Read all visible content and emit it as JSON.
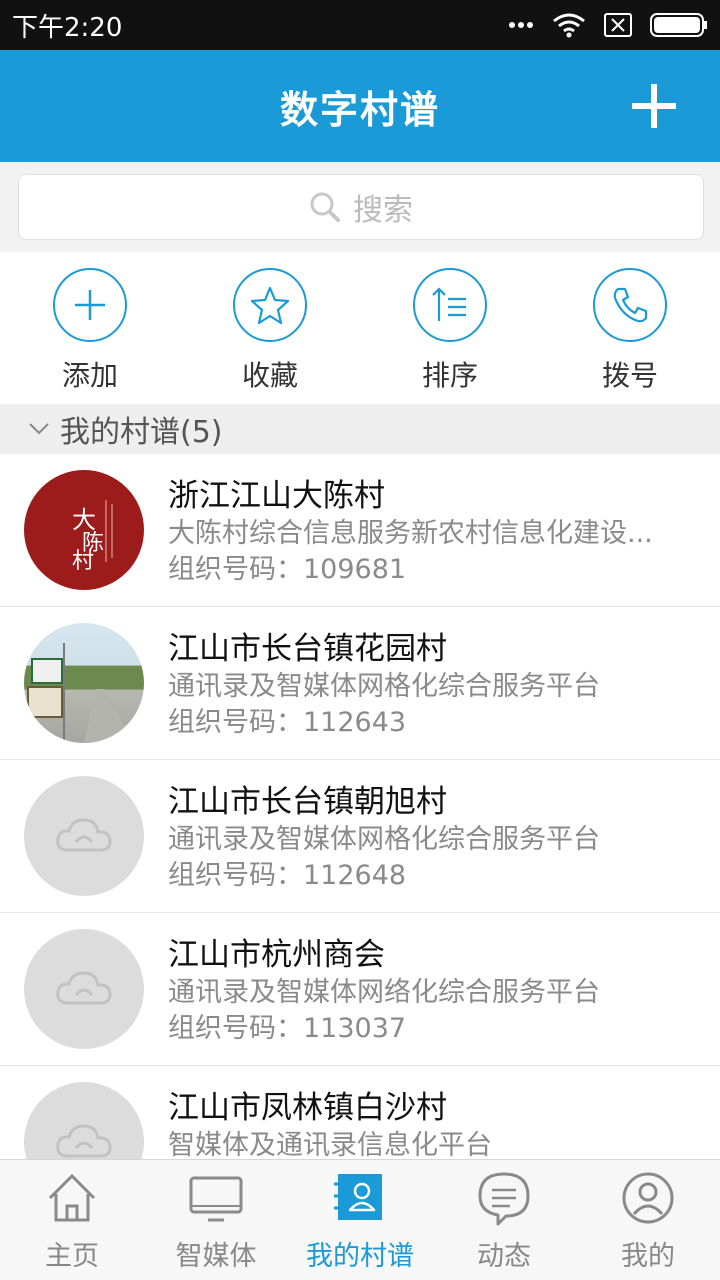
{
  "status_bar": {
    "time": "下午2:20"
  },
  "header": {
    "title": "数字村谱"
  },
  "search": {
    "placeholder": "搜索"
  },
  "actions": [
    {
      "label": "添加",
      "icon": "plus-icon"
    },
    {
      "label": "收藏",
      "icon": "star-icon"
    },
    {
      "label": "排序",
      "icon": "sort-icon"
    },
    {
      "label": "拨号",
      "icon": "phone-icon"
    }
  ],
  "section": {
    "label": "我的村谱(5)"
  },
  "villages": [
    {
      "name": "浙江江山大陈村",
      "desc": "大陈村综合信息服务新农村信息化建设...",
      "org": "组织号码：109681",
      "avatar": "logo-avatar"
    },
    {
      "name": "江山市长台镇花园村",
      "desc": "通讯录及智媒体网格化综合服务平台",
      "org": "组织号码：112643",
      "avatar": "photo-avatar"
    },
    {
      "name": "江山市长台镇朝旭村",
      "desc": "通讯录及智媒体网格化综合服务平台",
      "org": "组织号码：112648",
      "avatar": "cloud-icon"
    },
    {
      "name": "江山市杭州商会",
      "desc": "通讯录及智媒体网络化综合服务平台",
      "org": "组织号码：113037",
      "avatar": "cloud-icon"
    },
    {
      "name": "江山市凤林镇白沙村",
      "desc": "智媒体及通讯录信息化平台",
      "org": "",
      "avatar": "cloud-icon"
    }
  ],
  "tabs": [
    {
      "label": "主页",
      "icon": "home-icon",
      "active": false
    },
    {
      "label": "智媒体",
      "icon": "monitor-icon",
      "active": false
    },
    {
      "label": "我的村谱",
      "icon": "contacts-icon",
      "active": true
    },
    {
      "label": "动态",
      "icon": "chat-icon",
      "active": false
    },
    {
      "label": "我的",
      "icon": "user-icon",
      "active": false
    }
  ],
  "colors": {
    "accent": "#1a9ad6"
  }
}
